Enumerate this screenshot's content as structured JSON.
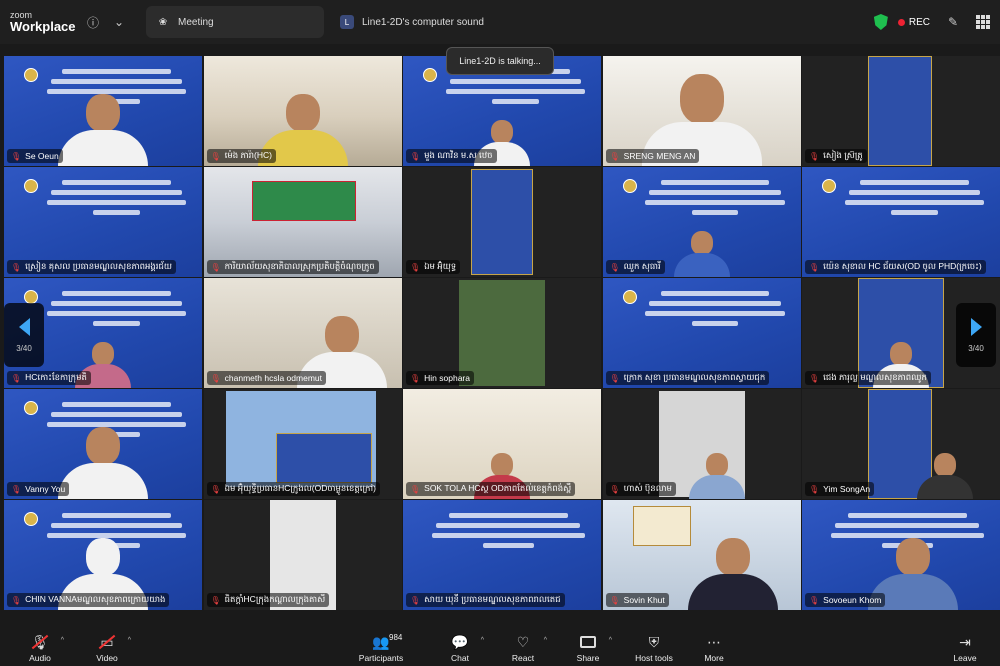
{
  "app": {
    "brand_top": "zoom",
    "brand_bottom": "Workplace"
  },
  "tabs": [
    {
      "label": "Meeting",
      "icon": "paw-icon",
      "active": true
    },
    {
      "label": "Line1-2D's computer sound",
      "icon_letter": "L",
      "active": false
    }
  ],
  "status": {
    "rec_label": "REC",
    "security_color": "#1fbf4f",
    "rec_color": "#ee2233"
  },
  "talking_toast": "Line1-2D is talking...",
  "pager": {
    "left_label": "3/40",
    "right_label": "3/40",
    "arrow_color": "#3ea7f5"
  },
  "participants": [
    {
      "name": "Se Oeun"
    },
    {
      "name": "ម៉េង ភារ៉ា(HC)"
    },
    {
      "name": "មួង ណាវិន ម.ស ឋេច"
    },
    {
      "name": "SRENG MENG AN"
    },
    {
      "name": "សៀង ស្រ៊ត្រូ"
    },
    {
      "name": "ស្រៀន គុសល ប្រធានមណ្ឌលសុខភាពអង្គរជ័យ"
    },
    {
      "name": "ការិយាល័យសុខាភិបាលស្រុកប្រតិបត្តិចំណុចក្រូច"
    },
    {
      "name": "ឯម អ៊ុំយុទ្ធ"
    },
    {
      "name": "ឈួក សុធារី"
    },
    {
      "name": "យ៉េន សុខាល HC ជ័យស(OD ចូល PHD(ក្រចេះ)"
    },
    {
      "name": "HCកោះខែកាក្រុមតិ"
    },
    {
      "name": "chanmeth hcsla odmemut"
    },
    {
      "name": "Hin sophara"
    },
    {
      "name": "ក្រោក សុខា ប្រធានមណ្ឌលសុខភាពស្វាយជុក"
    },
    {
      "name": "ជេង ភារុល្ល មណ្ឌលសុខភាពឈូក"
    },
    {
      "name": "Vanny You"
    },
    {
      "name": "ឯម អ៊ុំយុទ្ធិប្រធានHCក្រូងល(ODចាម្ងូនខេត្តក្រៅ)"
    },
    {
      "name": "SOK TOLA HCស្ថ ODភាពតែល់ខេត្តកំពង់ស្ពឺ"
    },
    {
      "name": "ហាស់ ប៊ុនលាម"
    },
    {
      "name": "Yim SongAn"
    },
    {
      "name": "CHIN VANNAមណ្ឌលសុខភាពក្រោយយាង"
    },
    {
      "name": "ធិតក្តាំHCក្រុងកណ្ដាលក្រុងតាសី"
    },
    {
      "name": "សាយ ឃុនី ប្រធានមណ្ឌលសុខភាពរាលតេជ"
    },
    {
      "name": "Sovin Khut"
    },
    {
      "name": "Sovoeun Khom"
    }
  ],
  "toolbar": {
    "audio": "Audio",
    "video": "Video",
    "participants": "Participants",
    "participants_count": "984",
    "chat": "Chat",
    "react": "React",
    "share": "Share",
    "host_tools": "Host tools",
    "more": "More",
    "leave": "Leave"
  }
}
